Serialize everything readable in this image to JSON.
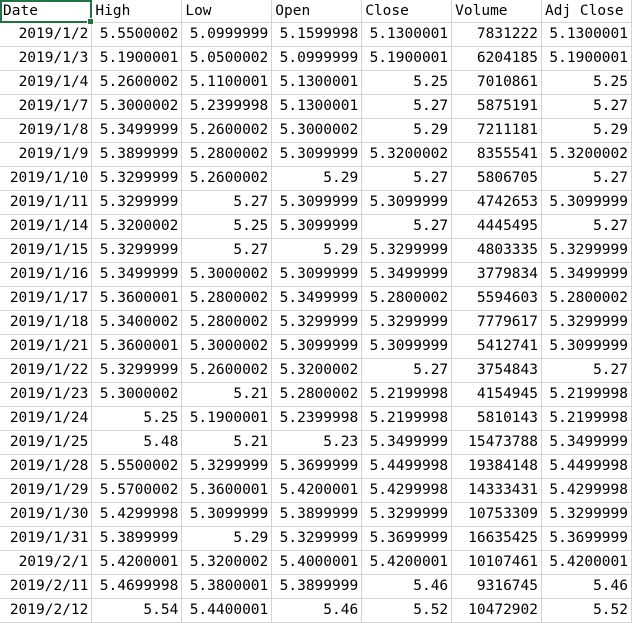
{
  "headers": [
    "Date",
    "High",
    "Low",
    "Open",
    "Close",
    "Volume",
    "Adj Close"
  ],
  "rows": [
    [
      "2019/1/2",
      "5.5500002",
      "5.0999999",
      "5.1599998",
      "5.1300001",
      "7831222",
      "5.1300001"
    ],
    [
      "2019/1/3",
      "5.1900001",
      "5.0500002",
      "5.0999999",
      "5.1900001",
      "6204185",
      "5.1900001"
    ],
    [
      "2019/1/4",
      "5.2600002",
      "5.1100001",
      "5.1300001",
      "5.25",
      "7010861",
      "5.25"
    ],
    [
      "2019/1/7",
      "5.3000002",
      "5.2399998",
      "5.1300001",
      "5.27",
      "5875191",
      "5.27"
    ],
    [
      "2019/1/8",
      "5.3499999",
      "5.2600002",
      "5.3000002",
      "5.29",
      "7211181",
      "5.29"
    ],
    [
      "2019/1/9",
      "5.3899999",
      "5.2800002",
      "5.3099999",
      "5.3200002",
      "8355541",
      "5.3200002"
    ],
    [
      "2019/1/10",
      "5.3299999",
      "5.2600002",
      "5.29",
      "5.27",
      "5806705",
      "5.27"
    ],
    [
      "2019/1/11",
      "5.3299999",
      "5.27",
      "5.3099999",
      "5.3099999",
      "4742653",
      "5.3099999"
    ],
    [
      "2019/1/14",
      "5.3200002",
      "5.25",
      "5.3099999",
      "5.27",
      "4445495",
      "5.27"
    ],
    [
      "2019/1/15",
      "5.3299999",
      "5.27",
      "5.29",
      "5.3299999",
      "4803335",
      "5.3299999"
    ],
    [
      "2019/1/16",
      "5.3499999",
      "5.3000002",
      "5.3099999",
      "5.3499999",
      "3779834",
      "5.3499999"
    ],
    [
      "2019/1/17",
      "5.3600001",
      "5.2800002",
      "5.3499999",
      "5.2800002",
      "5594603",
      "5.2800002"
    ],
    [
      "2019/1/18",
      "5.3400002",
      "5.2800002",
      "5.3299999",
      "5.3299999",
      "7779617",
      "5.3299999"
    ],
    [
      "2019/1/21",
      "5.3600001",
      "5.3000002",
      "5.3099999",
      "5.3099999",
      "5412741",
      "5.3099999"
    ],
    [
      "2019/1/22",
      "5.3299999",
      "5.2600002",
      "5.3200002",
      "5.27",
      "3754843",
      "5.27"
    ],
    [
      "2019/1/23",
      "5.3000002",
      "5.21",
      "5.2800002",
      "5.2199998",
      "4154945",
      "5.2199998"
    ],
    [
      "2019/1/24",
      "5.25",
      "5.1900001",
      "5.2399998",
      "5.2199998",
      "5810143",
      "5.2199998"
    ],
    [
      "2019/1/25",
      "5.48",
      "5.21",
      "5.23",
      "5.3499999",
      "15473788",
      "5.3499999"
    ],
    [
      "2019/1/28",
      "5.5500002",
      "5.3299999",
      "5.3699999",
      "5.4499998",
      "19384148",
      "5.4499998"
    ],
    [
      "2019/1/29",
      "5.5700002",
      "5.3600001",
      "5.4200001",
      "5.4299998",
      "14333431",
      "5.4299998"
    ],
    [
      "2019/1/30",
      "5.4299998",
      "5.3099999",
      "5.3899999",
      "5.3299999",
      "10753309",
      "5.3299999"
    ],
    [
      "2019/1/31",
      "5.3899999",
      "5.29",
      "5.3299999",
      "5.3699999",
      "16635425",
      "5.3699999"
    ],
    [
      "2019/2/1",
      "5.4200001",
      "5.3200002",
      "5.4000001",
      "5.4200001",
      "10107461",
      "5.4200001"
    ],
    [
      "2019/2/11",
      "5.4699998",
      "5.3800001",
      "5.3899999",
      "5.46",
      "9316745",
      "5.46"
    ],
    [
      "2019/2/12",
      "5.54",
      "5.4400001",
      "5.46",
      "5.52",
      "10472902",
      "5.52"
    ]
  ]
}
